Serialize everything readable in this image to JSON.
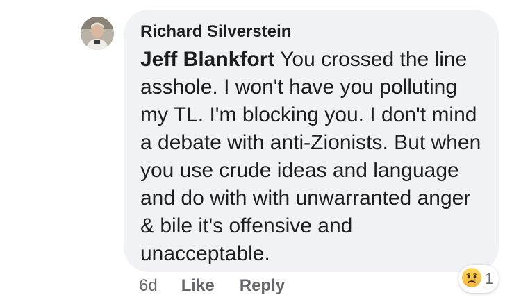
{
  "comment": {
    "author": "Richard Silverstein",
    "mention": "Jeff Blankfort",
    "text": " You crossed the line asshole. I won't have you polluting my TL.  I'm blocking you. I don't mind a debate with anti-Zionists.  But when you use crude ideas and language and do with with unwarranted anger & bile it's offensive and unacceptable."
  },
  "actions": {
    "timestamp": "6d",
    "like_label": "Like",
    "reply_label": "Reply"
  },
  "reactions": {
    "icon": "sad-reaction-icon",
    "count": "1"
  }
}
